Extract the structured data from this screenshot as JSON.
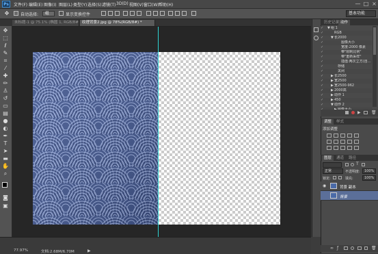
{
  "app": {
    "logo": "Ps"
  },
  "menu": [
    "文件(F)",
    "编辑(E)",
    "图像(I)",
    "图层(L)",
    "类型(Y)",
    "选择(S)",
    "滤镜(T)",
    "3D(D)",
    "视图(V)",
    "窗口(W)",
    "帮助(H)"
  ],
  "window_controls": [
    "—",
    "□",
    "×"
  ],
  "options": {
    "auto_select_label": "自动选择:",
    "auto_select_value": "组",
    "show_transform_label": "显示变换控件",
    "workspace": "基本功能"
  },
  "tabs": [
    {
      "label": "未标题-1 @ 75.1% (椭圆 1, RGB/8#)",
      "active": false
    },
    {
      "label": "纹理背景2.jpg @ 78%(RGB/8#) *",
      "active": true
    }
  ],
  "status": {
    "zoom": "77.97%",
    "doc": "文档:2.68M/6.70M"
  },
  "actions_panel": {
    "tabs": [
      "历史记录",
      "动作"
    ],
    "rows": [
      {
        "indent": 0,
        "arrow": "▼",
        "label": "组 1"
      },
      {
        "indent": 1,
        "arrow": "",
        "label": "RGB"
      },
      {
        "indent": 1,
        "arrow": "▼",
        "label": "长2000"
      },
      {
        "indent": 3,
        "arrow": "",
        "label": "图像大小"
      },
      {
        "indent": 3,
        "arrow": "",
        "label": "宽度:2000 像素"
      },
      {
        "indent": 3,
        "arrow": "",
        "label": "带\"限制比例\""
      },
      {
        "indent": 3,
        "arrow": "",
        "label": "带\"重新采样\""
      },
      {
        "indent": 3,
        "arrow": "",
        "label": "插值:两次立方(自..."
      },
      {
        "indent": 2,
        "arrow": "",
        "label": "存储"
      },
      {
        "indent": 2,
        "arrow": "",
        "label": "关闭"
      },
      {
        "indent": 1,
        "arrow": "▶",
        "label": "长2500"
      },
      {
        "indent": 1,
        "arrow": "▶",
        "label": "宽2500"
      },
      {
        "indent": 1,
        "arrow": "▶",
        "label": "宽2500-962"
      },
      {
        "indent": 1,
        "arrow": "▶",
        "label": "2000高"
      },
      {
        "indent": 1,
        "arrow": "▶",
        "label": "动作 1"
      },
      {
        "indent": 1,
        "arrow": "▶",
        "label": "450"
      },
      {
        "indent": 1,
        "arrow": "▼",
        "label": "动作 2"
      },
      {
        "indent": 2,
        "arrow": "▶",
        "label": "图像大小"
      }
    ]
  },
  "adjustments_panel": {
    "tabs": [
      "调整",
      "样式"
    ],
    "title": "添加调整"
  },
  "layers_panel": {
    "tabs": [
      "图层",
      "通道",
      "路径"
    ],
    "blend_mode": "正常",
    "opacity_label": "不透明度:",
    "opacity_value": "100%",
    "lock_label": "锁定:",
    "fill_label": "填充:",
    "fill_value": "100%",
    "layers": [
      {
        "name": "背景 副本",
        "visible": true,
        "selected": false
      },
      {
        "name": "背景",
        "visible": false,
        "selected": true
      }
    ]
  }
}
